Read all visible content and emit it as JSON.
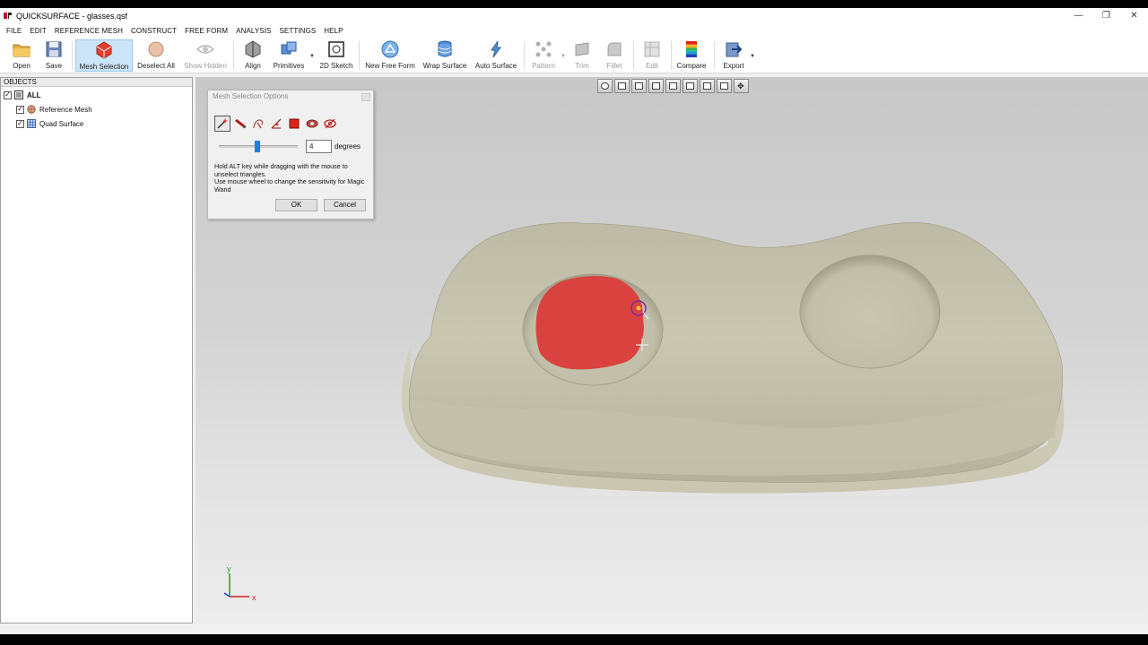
{
  "window": {
    "title": "QUICKSURFACE - glasses.qsf",
    "controls": [
      "minimize-icon",
      "restore-icon",
      "close-icon"
    ]
  },
  "menu": [
    "FILE",
    "EDIT",
    "REFERENCE MESH",
    "CONSTRUCT",
    "FREE FORM",
    "ANALYSIS",
    "SETTINGS",
    "HELP"
  ],
  "toolbar": {
    "open": "Open",
    "save": "Save",
    "mesh_selection": "Mesh Selection",
    "deselect_all": "Deselect All",
    "show_hidden": "Show Hidden",
    "align": "Align",
    "primitives": "Primitives",
    "sketch_2d": "2D Sketch",
    "new_free_form": "New Free Form",
    "wrap_surface": "Wrap Surface",
    "auto_surface": "Auto Surface",
    "pattern": "Pattern",
    "trim": "Trim",
    "fillet": "Fillet",
    "edit": "Edit",
    "compare": "Compare",
    "export": "Export"
  },
  "objects": {
    "header": "OBJECTS",
    "root": "ALL",
    "items": [
      {
        "label": "Reference Mesh",
        "checked": true
      },
      {
        "label": "Quad Surface",
        "checked": true
      }
    ]
  },
  "dialog": {
    "title": "Mesh Selection Options",
    "degrees_value": "4",
    "degrees_label": "degrees",
    "hint_line1": "Hold ALT key while dragging with the mouse to unselect triangles.",
    "hint_line2": "Use mouse wheel to change the sensitivity for Magic Wand",
    "ok": "OK",
    "cancel": "Cancel"
  },
  "viewport": {
    "axis_y": "y",
    "axis_x": "x",
    "mesh_color": "#c8c6b0",
    "selection_color": "#d9423e"
  }
}
